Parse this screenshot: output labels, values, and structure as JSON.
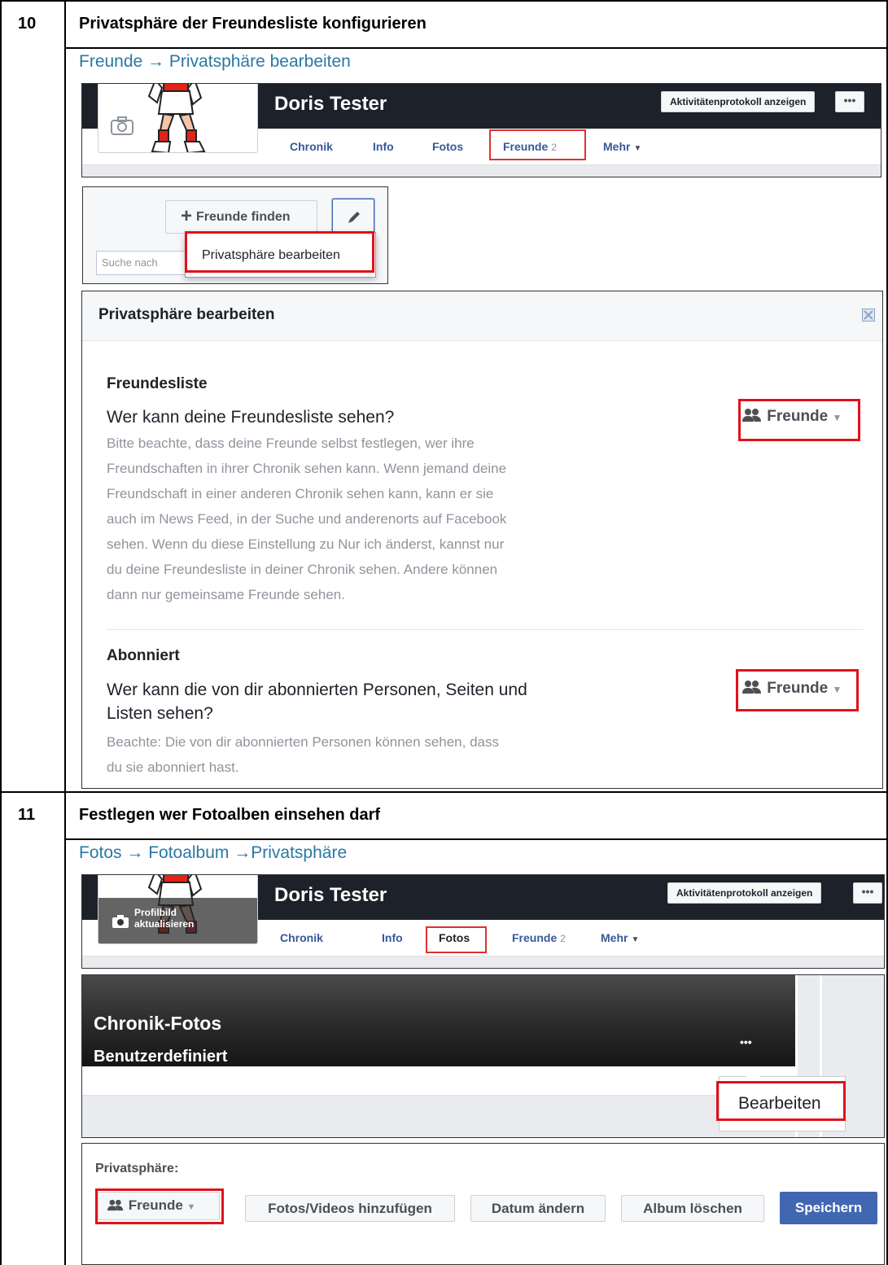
{
  "steps": [
    {
      "number": "10",
      "title": "Privatsphäre der Freundesliste konfigurieren",
      "path": "Freunde → Privatsphäre bearbeiten",
      "profile": {
        "name": "Doris Tester",
        "activity_button": "Aktivitätenprotokoll anzeigen",
        "more_button": "•••",
        "tabs": {
          "chronik": "Chronik",
          "info": "Info",
          "fotos": "Fotos",
          "freunde": "Freunde",
          "freunde_count": "2",
          "mehr": "Mehr"
        }
      },
      "find_friends": {
        "button_label": "Freunde finden",
        "search_placeholder": "Suche nach",
        "menu_item": "Privatsphäre bearbeiten"
      },
      "privacy_dialog": {
        "title": "Privatsphäre bearbeiten",
        "sections": [
          {
            "heading": "Freundesliste",
            "question": "Wer kann deine Freundesliste sehen?",
            "description_lines": [
              "Bitte beachte, dass deine Freunde selbst festlegen, wer ihre",
              "Freundschaften in ihrer Chronik sehen kann. Wenn jemand deine",
              "Freundschaft in einer anderen Chronik sehen kann, kann er sie",
              "auch im News Feed, in der Suche und anderenorts auf Facebook",
              "sehen. Wenn du diese Einstellung zu Nur ich änderst, kannst nur",
              "du deine Freundesliste in deiner Chronik sehen. Andere können",
              "dann nur gemeinsame Freunde sehen."
            ],
            "audience": "Freunde"
          },
          {
            "heading": "Abonniert",
            "question_lines": [
              "Wer kann die von dir abonnierten Personen, Seiten und",
              "Listen sehen?"
            ],
            "description_lines": [
              "Beachte: Die von dir abonnierten Personen können sehen, dass",
              "du sie abonniert hast."
            ],
            "audience": "Freunde"
          }
        ]
      }
    },
    {
      "number": "11",
      "title": "Festlegen wer Fotoalben einsehen darf",
      "path": "Fotos → Fotoalbum →Privatsphäre",
      "profile": {
        "name": "Doris Tester",
        "update_photo": "Profilbild aktualisieren",
        "update_photo_line1": "Profilbild",
        "update_photo_line2": "aktualisieren",
        "activity_button": "Aktivitätenprotokoll anzeigen",
        "more_button": "•••",
        "tabs": {
          "chronik": "Chronik",
          "info": "Info",
          "fotos": "Fotos",
          "freunde": "Freunde",
          "freunde_count": "2",
          "mehr": "Mehr"
        }
      },
      "album": {
        "title": "Chronik-Fotos",
        "subtitle": "Benutzerdefiniert",
        "menu_dots": "•••",
        "menu_item": "Bearbeiten"
      },
      "album_bar": {
        "privacy_label": "Privatsphäre:",
        "audience": "Freunde",
        "add_button": "Fotos/Videos hinzufügen",
        "date_button": "Datum ändern",
        "delete_button": "Album löschen",
        "save_button": "Speichern"
      }
    }
  ],
  "colors": {
    "highlight": "#e0121a",
    "link": "#2a77a5",
    "fb_blue": "#4267b2",
    "fb_dark": "#1d2129"
  }
}
